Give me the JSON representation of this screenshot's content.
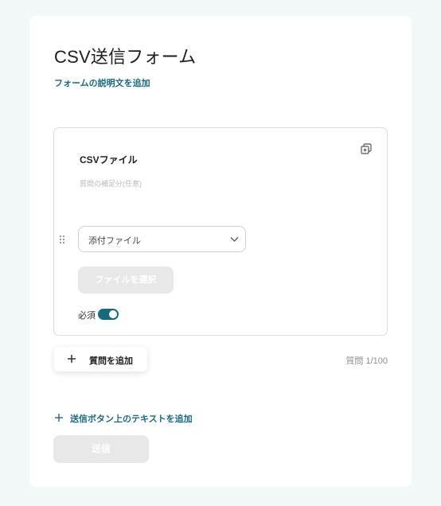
{
  "form": {
    "title": "CSV送信フォーム",
    "add_description_label": "フォームの説明文を追加"
  },
  "question": {
    "title": "CSVファイル",
    "note": "質問の補足分(任意)",
    "type_select": {
      "selected": "添付ファイル"
    },
    "file_button_label": "ファイルを選択",
    "required_label": "必須",
    "required_on": true
  },
  "actions": {
    "add_question_label": "質問を追加",
    "question_count": "質問 1/100",
    "add_submit_text_label": "送信ボタン上のテキストを追加",
    "submit_label": "送信"
  },
  "colors": {
    "accent": "#17697d",
    "link": "#1b6a80",
    "background": "#f1f8f7",
    "disabled_button": "#e8e8e8"
  },
  "icons": {
    "copy": "copy-icon",
    "drag": "drag-handle-icon",
    "chevron": "chevron-down-icon",
    "plus": "plus-icon"
  }
}
